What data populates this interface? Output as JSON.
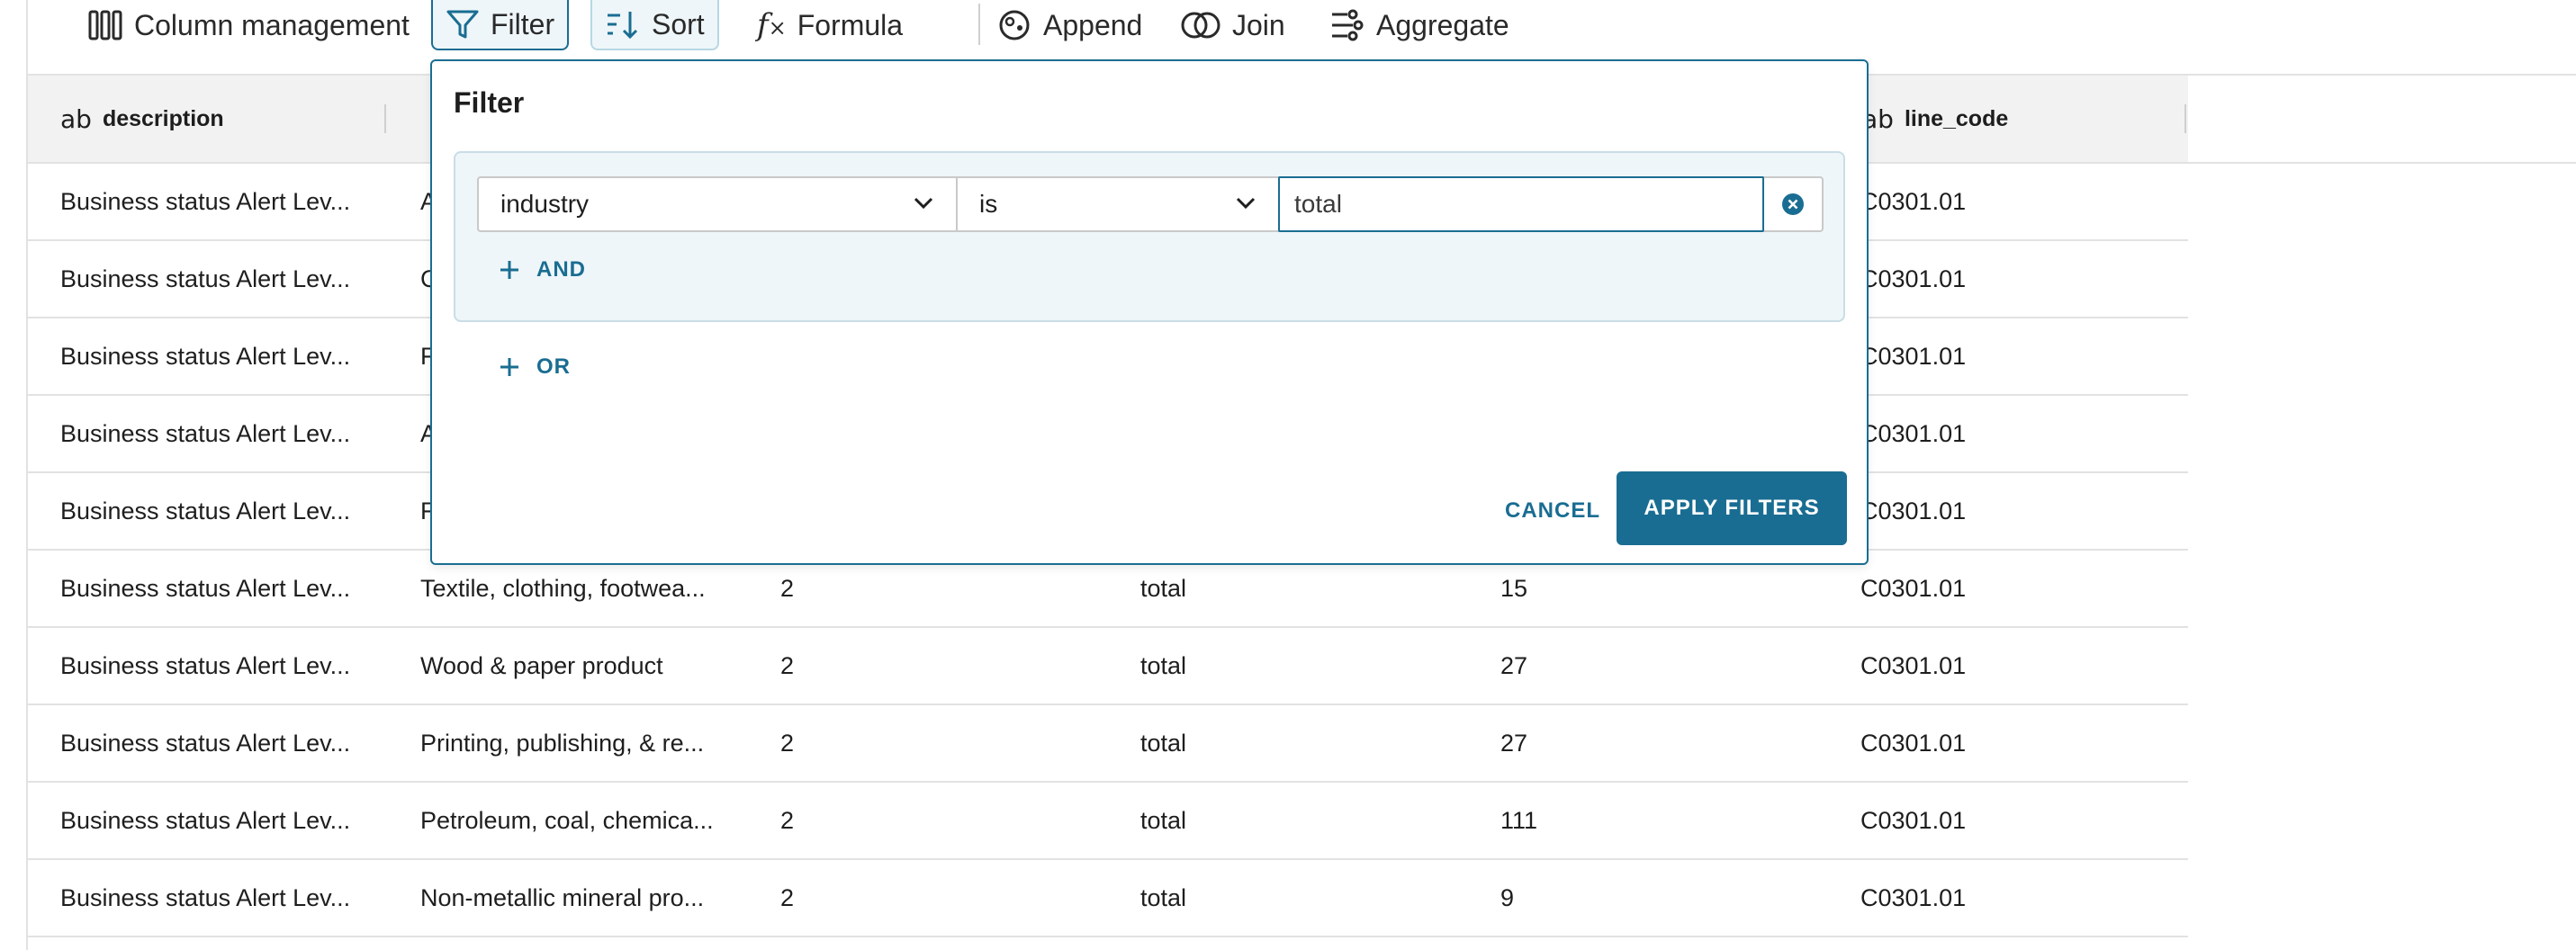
{
  "toolbar": {
    "column_management": "Column management",
    "filter": "Filter",
    "sort": "Sort",
    "formula": "Formula",
    "append": "Append",
    "join": "Join",
    "aggregate": "Aggregate"
  },
  "table": {
    "headers": {
      "description": {
        "type": "ab",
        "label": "description"
      },
      "line_code": {
        "type": "ab",
        "label": "line_code"
      }
    },
    "rows": [
      {
        "description": "Business status Alert Lev...",
        "industry": "A",
        "level": "",
        "value_col": "",
        "count": "",
        "line_code": "C0301.01"
      },
      {
        "description": "Business status Alert Lev...",
        "industry": "C",
        "level": "",
        "value_col": "",
        "count": "",
        "line_code": "C0301.01"
      },
      {
        "description": "Business status Alert Lev...",
        "industry": "F",
        "level": "",
        "value_col": "",
        "count": "",
        "line_code": "C0301.01"
      },
      {
        "description": "Business status Alert Lev...",
        "industry": "A",
        "level": "",
        "value_col": "",
        "count": "",
        "line_code": "C0301.01"
      },
      {
        "description": "Business status Alert Lev...",
        "industry": "F",
        "level": "",
        "value_col": "",
        "count": "",
        "line_code": "C0301.01"
      },
      {
        "description": "Business status Alert Lev...",
        "industry": "Textile, clothing, footwea...",
        "level": "2",
        "value_col": "total",
        "count": "15",
        "line_code": "C0301.01"
      },
      {
        "description": "Business status Alert Lev...",
        "industry": "Wood & paper product",
        "level": "2",
        "value_col": "total",
        "count": "27",
        "line_code": "C0301.01"
      },
      {
        "description": "Business status Alert Lev...",
        "industry": "Printing, publishing, & re...",
        "level": "2",
        "value_col": "total",
        "count": "27",
        "line_code": "C0301.01"
      },
      {
        "description": "Business status Alert Lev...",
        "industry": "Petroleum, coal, chemica...",
        "level": "2",
        "value_col": "total",
        "count": "111",
        "line_code": "C0301.01"
      },
      {
        "description": "Business status Alert Lev...",
        "industry": "Non-metallic mineral pro...",
        "level": "2",
        "value_col": "total",
        "count": "9",
        "line_code": "C0301.01"
      }
    ]
  },
  "filter_panel": {
    "title": "Filter",
    "condition": {
      "column": "industry",
      "operator": "is",
      "value": "total"
    },
    "add_and": "AND",
    "add_or": "OR",
    "cancel": "CANCEL",
    "apply": "APPLY FILTERS"
  },
  "colors": {
    "accent": "#1a6d92",
    "group_bg": "#eef6f9"
  }
}
